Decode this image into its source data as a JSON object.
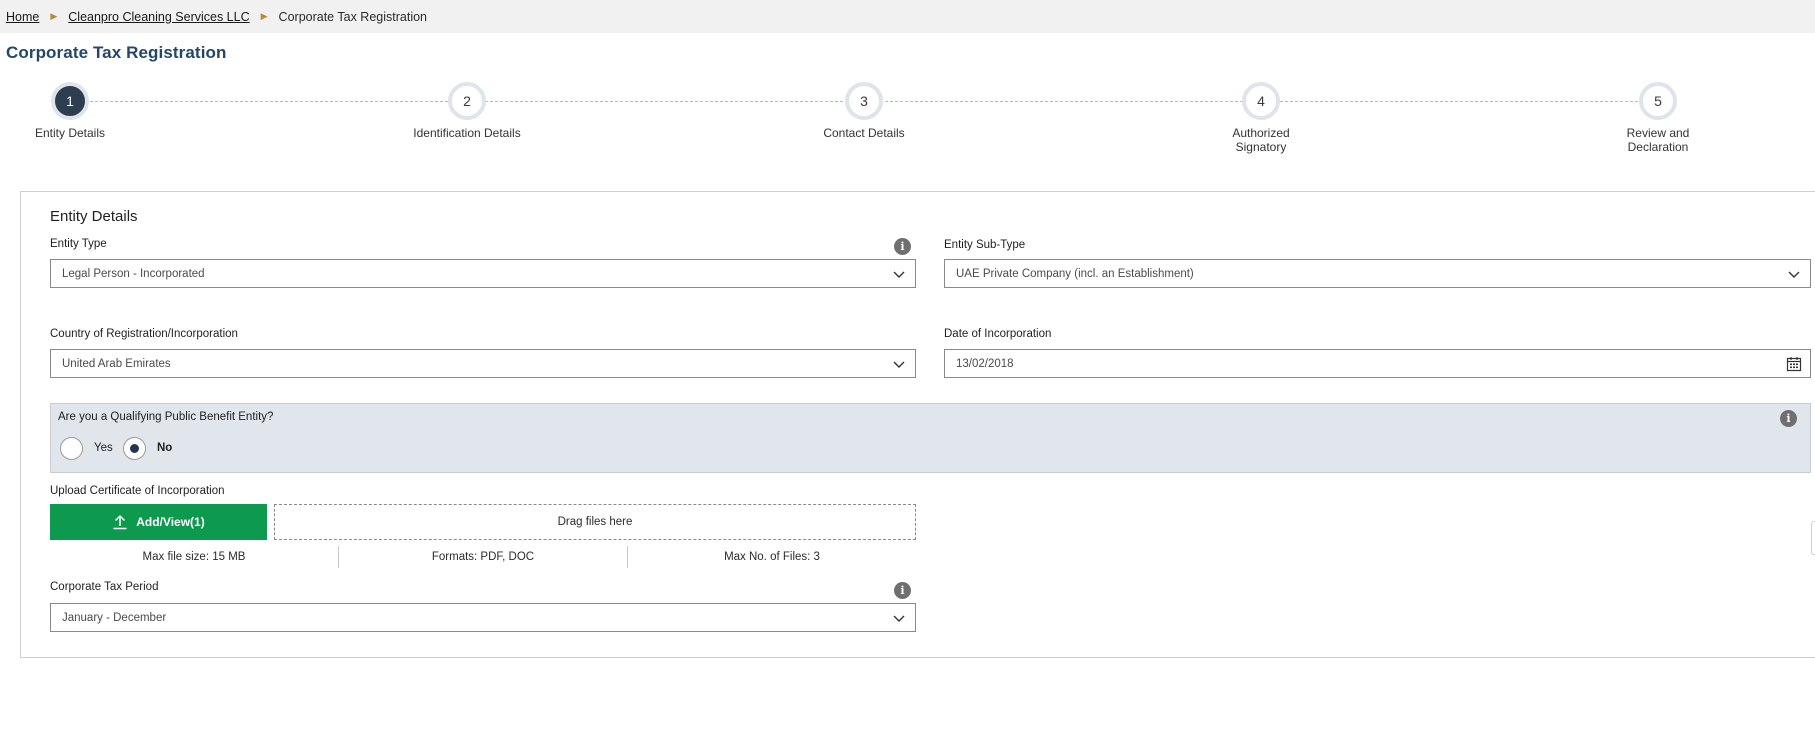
{
  "breadcrumb": {
    "items": [
      "Home",
      "Cleanpro Cleaning Services LLC"
    ],
    "current": "Corporate Tax Registration"
  },
  "page_title": "Corporate Tax Registration",
  "stepper": {
    "steps": [
      {
        "number": "1",
        "label": "Entity Details",
        "active": true
      },
      {
        "number": "2",
        "label": "Identification Details",
        "active": false
      },
      {
        "number": "3",
        "label": "Contact Details",
        "active": false
      },
      {
        "number": "4",
        "label": "Authorized Signatory",
        "active": false
      },
      {
        "number": "5",
        "label": "Review and Declaration",
        "active": false
      }
    ]
  },
  "form": {
    "section_title": "Entity Details",
    "entity_type": {
      "label": "Entity Type",
      "value": "Legal Person - Incorporated"
    },
    "entity_sub_type": {
      "label": "Entity Sub-Type",
      "value": "UAE Private Company (incl. an Establishment)"
    },
    "country": {
      "label": "Country of Registration/Incorporation",
      "value": "United Arab Emirates"
    },
    "date_of_incorporation": {
      "label": "Date of Incorporation",
      "value": "13/02/2018"
    },
    "qpbe": {
      "question": "Are you a Qualifying Public Benefit Entity?",
      "options": [
        "Yes",
        "No"
      ],
      "selected": "No"
    },
    "upload": {
      "label": "Upload Certificate of Incorporation",
      "button_label": "Add/View(1)",
      "dropzone_text": "Drag files here",
      "max_size": "Max file size: 15 MB",
      "formats": "Formats: PDF, DOC",
      "max_files": "Max No. of Files: 3"
    },
    "tax_period": {
      "label": "Corporate Tax Period",
      "value": "January - December"
    }
  },
  "colors": {
    "title": "#23476a",
    "active_step": "#2d3e50",
    "upload_button": "#0d9a4f",
    "qpbe_background": "#e1e5ec",
    "breadcrumb_separator": "#b8893a"
  },
  "icons": {
    "info": "info-icon",
    "select": "chevron-down-icon",
    "date": "calendar-icon",
    "upload": "upload-icon",
    "separator": "triangle-right-icon"
  }
}
